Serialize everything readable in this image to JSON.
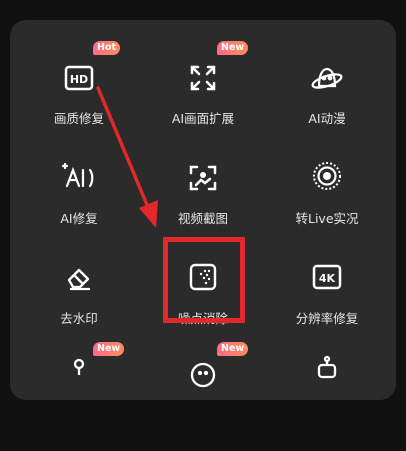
{
  "tools": [
    {
      "label": "画质修复",
      "icon": "hd-icon",
      "badge": "Hot"
    },
    {
      "label": "AI画面扩展",
      "icon": "expand-frame-icon",
      "badge": "New"
    },
    {
      "label": "AI动漫",
      "icon": "ai-anime-planet-icon"
    },
    {
      "label": "AI修复",
      "icon": "ai-sparkle-icon"
    },
    {
      "label": "视频截图",
      "icon": "video-screenshot-icon"
    },
    {
      "label": "转Live实况",
      "icon": "live-photo-icon"
    },
    {
      "label": "去水印",
      "icon": "eraser-icon"
    },
    {
      "label": "噪点消除",
      "icon": "denoise-icon"
    },
    {
      "label": "分辨率修复",
      "icon": "4k-icon"
    },
    {
      "label": "",
      "icon": "partial-icon",
      "badge": "New"
    },
    {
      "label": "",
      "icon": "partial-icon",
      "badge": "New"
    },
    {
      "label": "",
      "icon": "robot-icon"
    }
  ],
  "badges": {
    "hot": "Hot",
    "new": "New"
  },
  "icon_4k_text": "4K",
  "icon_hd_text": "HD",
  "annotation": {
    "arrow_color": "#e3282b",
    "highlight_color": "#e3282b",
    "highlight_target": "噪点消除"
  }
}
